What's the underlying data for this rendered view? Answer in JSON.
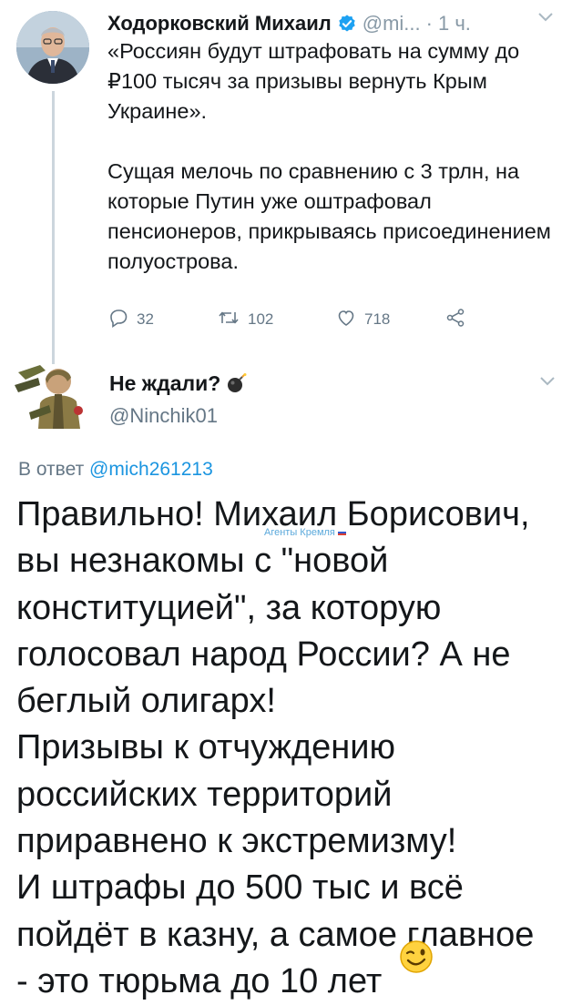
{
  "parent_tweet": {
    "author_name": "Ходорковский Михаил",
    "handle_truncated": "@mi...",
    "separator": "·",
    "time": "1 ч.",
    "text_paragraphs": [
      "«Россиян будут штрафовать на сумму до ₽100 тысяч за призывы вернуть Крым Украине».",
      "Сущая мелочь по сравнению с 3 трлн, на которые Путин уже оштрафовал пенсионеров, прикрываясь присоединением полуострова."
    ],
    "actions": {
      "replies": "32",
      "retweets": "102",
      "likes": "718"
    }
  },
  "reply_tweet": {
    "author_name": "Не ждали?",
    "handle": "@Ninchik01",
    "reply_to_prefix": "В ответ",
    "reply_to_handle": "@mich261213",
    "text_lines": [
      "Правильно! Михаил Борисович,",
      "вы незнакомы с \"новой",
      "конституцией\", за которую",
      "голосовал народ России? А не",
      "беглый олигарх!",
      "Призывы к отчуждению",
      "российских территорий",
      "приравнено к экстремизму!",
      "И штрафы до 500 тыс и всё",
      "пойдёт в казну, а самое главное",
      "- это тюрьма до 10 лет"
    ]
  },
  "watermark": "Агенты Кремля",
  "colors": {
    "link_blue": "#1b95e0",
    "meta_gray": "#657786",
    "thread_line": "#ccd6dd"
  },
  "icons": [
    "verified-icon",
    "chevron-down-icon",
    "reply-icon",
    "retweet-icon",
    "like-icon",
    "share-icon",
    "bomb-icon",
    "wink-emoji-icon"
  ]
}
